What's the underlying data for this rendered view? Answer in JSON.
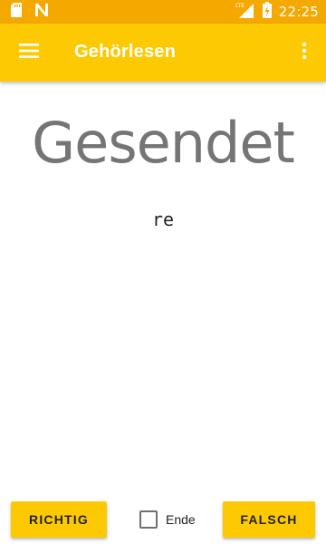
{
  "status_bar": {
    "time": "22:25",
    "network_label": "LTE",
    "left_icons": [
      "sd-card-icon",
      "app-n-icon"
    ],
    "right_icons": [
      "signal-icon",
      "battery-icon"
    ]
  },
  "toolbar": {
    "title": "Gehörlesen",
    "menu_icon": "hamburger-menu-icon",
    "overflow_icon": "more-vertical-icon"
  },
  "content": {
    "word": "Gesendet",
    "morse_text": "re"
  },
  "controls": {
    "correct_label": "RICHTIG",
    "end_label": "Ende",
    "end_checked": false,
    "wrong_label": "FALSCH"
  },
  "colors": {
    "status_bar": "#f5a800",
    "toolbar": "#fdc902",
    "button": "#fdc902",
    "word_text": "#757575"
  }
}
